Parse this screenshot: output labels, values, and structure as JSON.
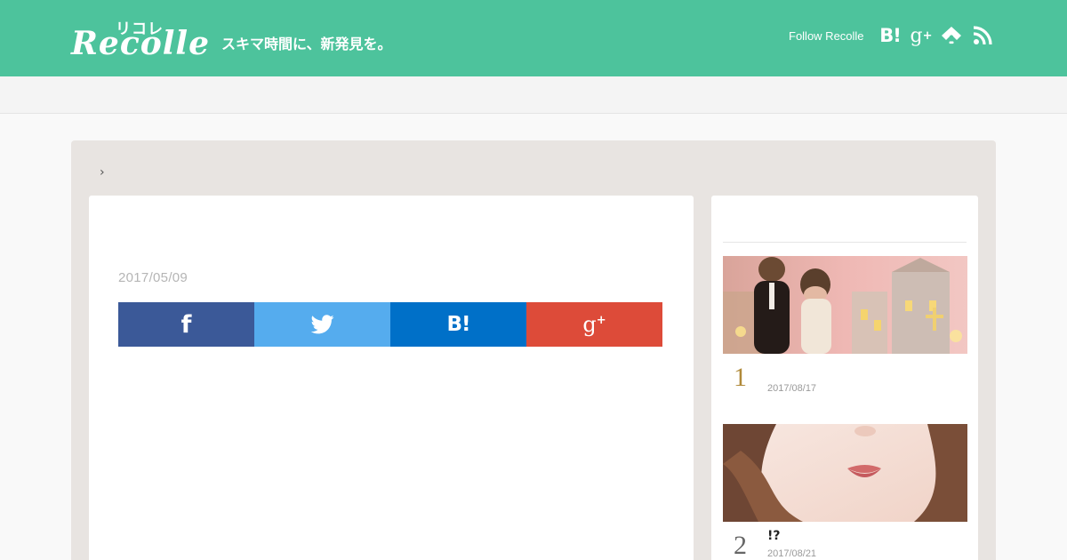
{
  "header": {
    "logo_kana": "リコレ",
    "logo_text": "Recolle",
    "tagline": "スキマ時間に、新発見を。",
    "follow_label": "Follow Recolle",
    "social_icons": [
      "hatena-bookmark-icon",
      "google-plus-icon",
      "feedly-icon",
      "rss-icon"
    ],
    "hatena_text": "B!",
    "gplus_text": "g",
    "gplus_sup": "+"
  },
  "breadcrumb": {
    "separator": "›"
  },
  "article": {
    "date": "2017/05/09",
    "share": {
      "facebook": "f",
      "hatena": "B!",
      "gplus": "g",
      "gplus_sup": "+"
    }
  },
  "sidebar": {
    "ranking": [
      {
        "rank": "1",
        "title": "",
        "date": "2017/08/17",
        "thumb": "wedding-figurines-image"
      },
      {
        "rank": "2",
        "title": "!?",
        "date": "2017/08/21",
        "thumb": "woman-lips-image"
      }
    ]
  },
  "colors": {
    "header_bg": "#4dc39c",
    "facebook": "#3b5998",
    "twitter": "#55acee",
    "hatena": "#0070c8",
    "google_plus": "#dd4b39",
    "rank1": "#b08a3a"
  }
}
